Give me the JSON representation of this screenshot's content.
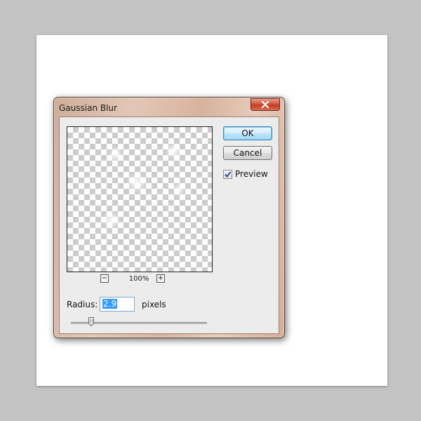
{
  "dialog": {
    "title": "Gaussian Blur",
    "buttons": {
      "ok_label": "OK",
      "cancel_label": "Cancel"
    },
    "preview": {
      "label": "Preview",
      "checked": true
    },
    "zoom": {
      "minus_label": "−",
      "plus_label": "+",
      "level": "100%"
    },
    "radius": {
      "label": "Radius:",
      "value": "2.9",
      "units": "pixels",
      "slider_fraction": 0.15
    }
  },
  "icons": {
    "close": "close-icon",
    "check": "checkmark-icon",
    "slider_thumb": "slider-thumb-icon"
  },
  "colors": {
    "frame": "#d9b8a3",
    "close_button": "#c9462b",
    "default_button": "#a7d9f5",
    "selection": "#3399ff"
  }
}
